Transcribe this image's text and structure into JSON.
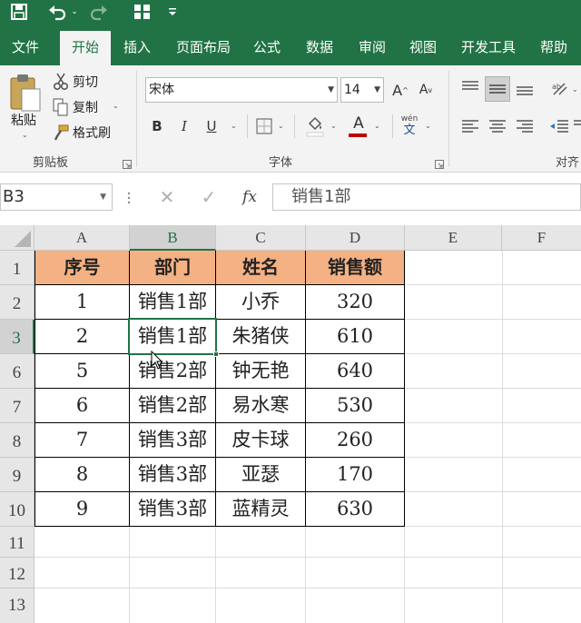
{
  "quick_access": {
    "save_icon": "save-icon",
    "undo_icon": "undo-icon",
    "redo_icon": "redo-icon",
    "layout_icon": "layout-icon",
    "customize_icon": "customize-arrow-icon"
  },
  "tabs": [
    {
      "label": "文件"
    },
    {
      "label": "开始"
    },
    {
      "label": "插入"
    },
    {
      "label": "页面布局"
    },
    {
      "label": "公式"
    },
    {
      "label": "数据"
    },
    {
      "label": "审阅"
    },
    {
      "label": "视图"
    },
    {
      "label": "开发工具"
    },
    {
      "label": "帮助"
    }
  ],
  "active_tab": "开始",
  "ribbon": {
    "clipboard": {
      "paste_label": "粘贴",
      "cut_label": "剪切",
      "copy_label": "复制",
      "format_painter_label": "格式刷",
      "group_label": "剪贴板"
    },
    "font": {
      "font_name": "宋体",
      "font_size": "14",
      "increase_font": "A",
      "decrease_font": "A",
      "bold": "B",
      "italic": "I",
      "underline": "U",
      "font_color": "A",
      "phonetic_top": "wén",
      "phonetic_bottom": "文",
      "group_label": "字体"
    },
    "alignment": {
      "group_label": "对齐"
    }
  },
  "formula_bar": {
    "name_box": "B3",
    "cancel": "✕",
    "enter": "✓",
    "fx": "fx",
    "value": "销售1部"
  },
  "grid": {
    "columns": [
      "A",
      "B",
      "C",
      "D",
      "E",
      "F"
    ],
    "rows": [
      "1",
      "2",
      "3",
      "6",
      "7",
      "8",
      "9",
      "10",
      "11",
      "12",
      "13"
    ],
    "header_row": [
      "序号",
      "部门",
      "姓名",
      "销售额"
    ],
    "data_rows": [
      [
        "1",
        "销售1部",
        "小乔",
        "320"
      ],
      [
        "2",
        "销售1部",
        "朱猪侠",
        "610"
      ],
      [
        "5",
        "销售2部",
        "钟无艳",
        "640"
      ],
      [
        "6",
        "销售2部",
        "易水寒",
        "530"
      ],
      [
        "7",
        "销售3部",
        "皮卡球",
        "260"
      ],
      [
        "8",
        "销售3部",
        "亚瑟",
        "170"
      ],
      [
        "9",
        "销售3部",
        "蓝精灵",
        "630"
      ]
    ],
    "selected_cell": "B3"
  },
  "colors": {
    "accent": "#217346",
    "header_fill": "#f4b183"
  }
}
